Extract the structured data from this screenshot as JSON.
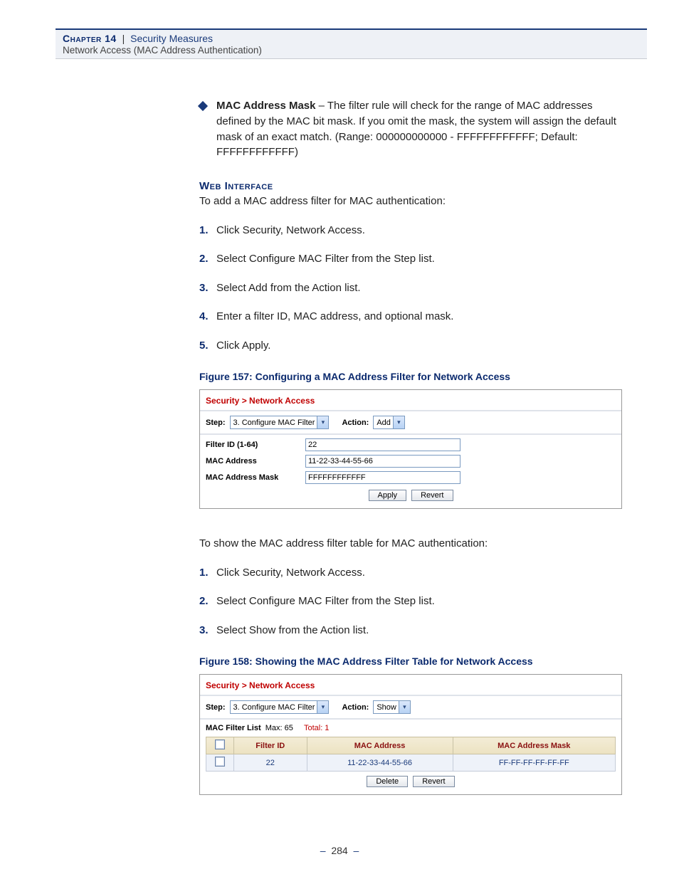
{
  "header": {
    "chapter": "Chapter 14",
    "separator": "|",
    "title": "Security Measures",
    "subtitle": "Network Access (MAC Address Authentication)"
  },
  "bullet": {
    "term": "MAC Address Mask",
    "text": " – The filter rule will check for the range of MAC addresses defined by the MAC bit mask. If you omit the mask, the system will assign the default mask of an exact match. (Range: 000000000000 - FFFFFFFFFFFF; Default: FFFFFFFFFFFF)"
  },
  "web_interface_heading": "Web Interface",
  "intro_add": "To add a MAC address filter for MAC authentication:",
  "steps_add": [
    "Click Security, Network Access.",
    "Select Configure MAC Filter from the Step list.",
    "Select Add from the Action list.",
    "Enter a filter ID, MAC address, and optional mask.",
    "Click Apply."
  ],
  "figure157_caption": "Figure 157:  Configuring a MAC Address Filter for Network Access",
  "ss1": {
    "crumb": "Security > Network Access",
    "step_label": "Step:",
    "step_value": "3. Configure MAC Filter",
    "action_label": "Action:",
    "action_value": "Add",
    "fields": {
      "filter_id_label": "Filter ID (1-64)",
      "filter_id_value": "22",
      "mac_label": "MAC Address",
      "mac_value": "11-22-33-44-55-66",
      "mask_label": "MAC Address Mask",
      "mask_value": "FFFFFFFFFFFF"
    },
    "apply": "Apply",
    "revert": "Revert"
  },
  "intro_show": "To show the MAC address filter table for MAC authentication:",
  "steps_show": [
    "Click Security, Network Access.",
    "Select Configure MAC Filter from the Step list.",
    "Select Show from the Action list."
  ],
  "figure158_caption": "Figure 158:  Showing the MAC Address Filter Table for Network Access",
  "ss2": {
    "crumb": "Security > Network Access",
    "step_label": "Step:",
    "step_value": "3. Configure MAC Filter",
    "action_label": "Action:",
    "action_value": "Show",
    "list_label": "MAC Filter List",
    "list_max": "Max: 65",
    "list_total": "Total: 1",
    "cols": {
      "filter_id": "Filter ID",
      "mac": "MAC Address",
      "mask": "MAC Address Mask"
    },
    "row": {
      "filter_id": "22",
      "mac": "11-22-33-44-55-66",
      "mask": "FF-FF-FF-FF-FF-FF"
    },
    "delete": "Delete",
    "revert": "Revert"
  },
  "page_number": "284"
}
